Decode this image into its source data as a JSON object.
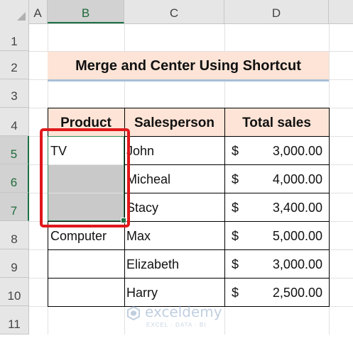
{
  "columns": [
    "A",
    "B",
    "C",
    "D"
  ],
  "rows": [
    "1",
    "2",
    "3",
    "4",
    "5",
    "6",
    "7",
    "8",
    "9",
    "10",
    "11"
  ],
  "title": "Merge and Center Using Shortcut",
  "table": {
    "headers": [
      "Product",
      "Salesperson",
      "Total sales"
    ],
    "rows": [
      {
        "product": "TV",
        "salesperson": "John",
        "currency": "$",
        "amount": "3,000.00"
      },
      {
        "product": "",
        "salesperson": "Micheal",
        "currency": "$",
        "amount": "4,000.00"
      },
      {
        "product": "",
        "salesperson": "Stacy",
        "currency": "$",
        "amount": "3,400.00"
      },
      {
        "product": "Computer",
        "salesperson": "Max",
        "currency": "$",
        "amount": "5,000.00"
      },
      {
        "product": "",
        "salesperson": "Elizabeth",
        "currency": "$",
        "amount": "3,000.00"
      },
      {
        "product": "",
        "salesperson": "Harry",
        "currency": "$",
        "amount": "2,500.00"
      }
    ]
  },
  "watermark": {
    "name": "exceldemy",
    "tagline": "EXCEL · DATA · BI"
  },
  "colors": {
    "header_fill": "#fde4d6",
    "selection_green": "#1e7145",
    "highlight_red": "#e0181b",
    "selected_fill": "#c9c9c9"
  }
}
